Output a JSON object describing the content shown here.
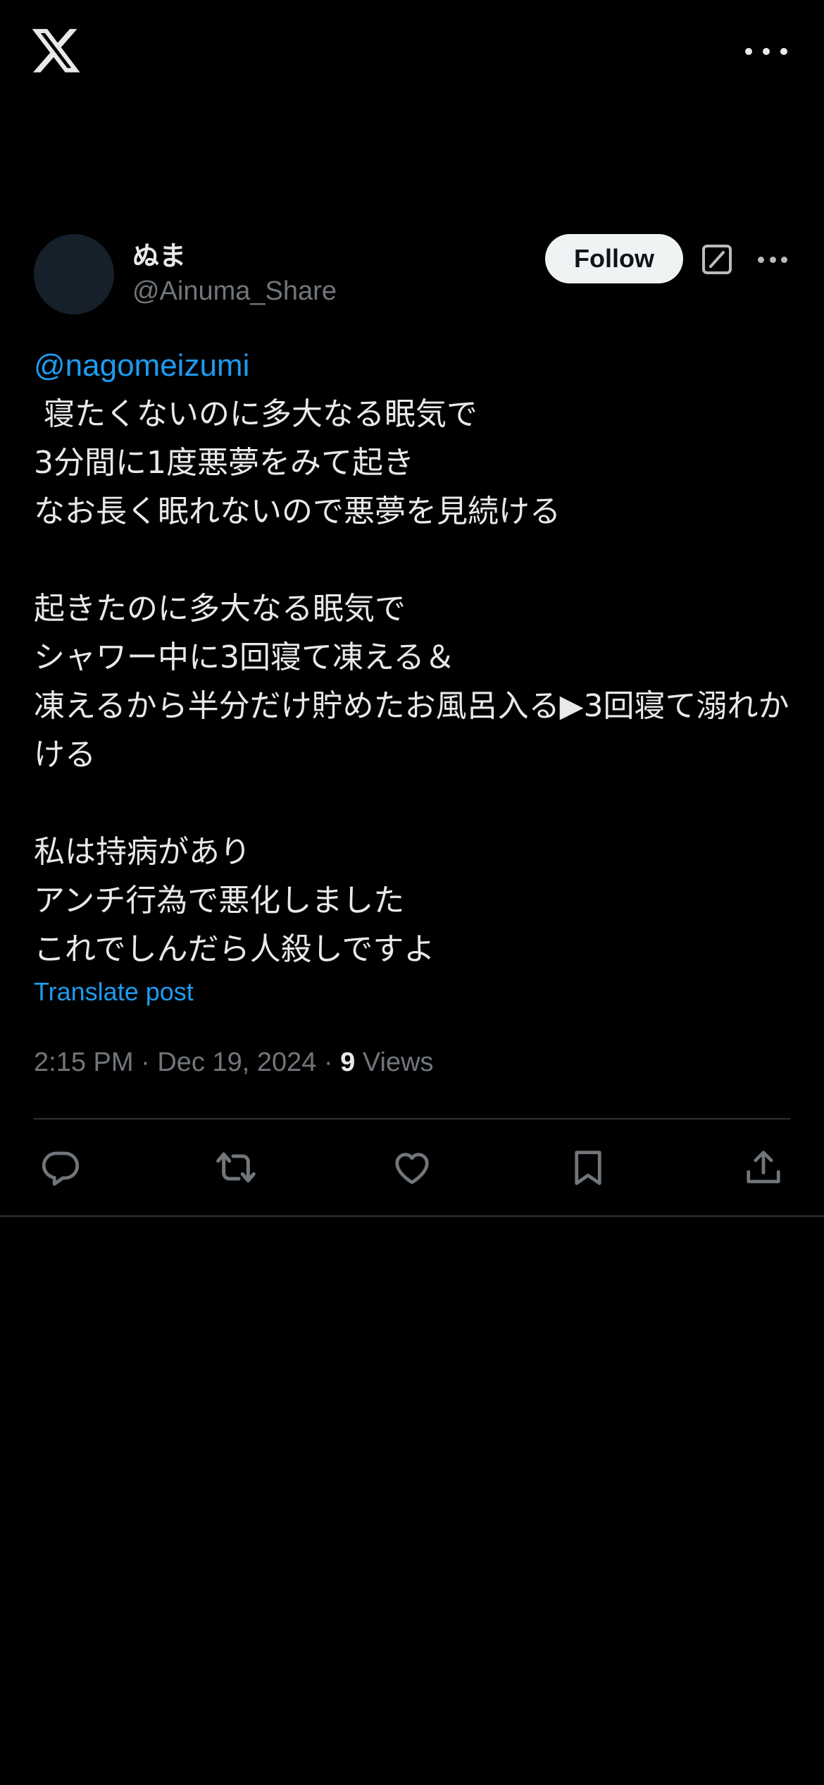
{
  "header": {
    "logo_icon": "x-logo-icon",
    "more_icon": "more-horizontal-icon"
  },
  "post": {
    "author": {
      "display_name": "ぬま",
      "handle": "@Ainuma_Share"
    },
    "follow_label": "Follow",
    "mention": "@nagomeizumi",
    "lines": [
      " 寝たくないのに多大なる眠気で",
      "3分間に1度悪夢をみて起き",
      "なお長く眠れないので悪夢を見続ける",
      "",
      "起きたのに多大なる眠気で",
      "シャワー中に3回寝て凍える＆",
      "凍えるから半分だけ貯めたお風呂入る▶3回寝て溺れかける",
      "",
      "私は持病があり",
      "アンチ行為で悪化しました",
      "これでしんだら人殺しですよ"
    ],
    "translate_label": "Translate post",
    "time": "2:15 PM",
    "date": "Dec 19, 2024",
    "views_count": "9",
    "views_label": "Views"
  },
  "actions": {
    "reply_icon": "reply-icon",
    "repost_icon": "repost-icon",
    "like_icon": "like-icon",
    "bookmark_icon": "bookmark-icon",
    "share_icon": "share-icon"
  },
  "colors": {
    "background": "#000000",
    "text": "#e7e9ea",
    "secondary": "#71767b",
    "accent": "#1d9bf0",
    "divider": "#2f3336"
  }
}
